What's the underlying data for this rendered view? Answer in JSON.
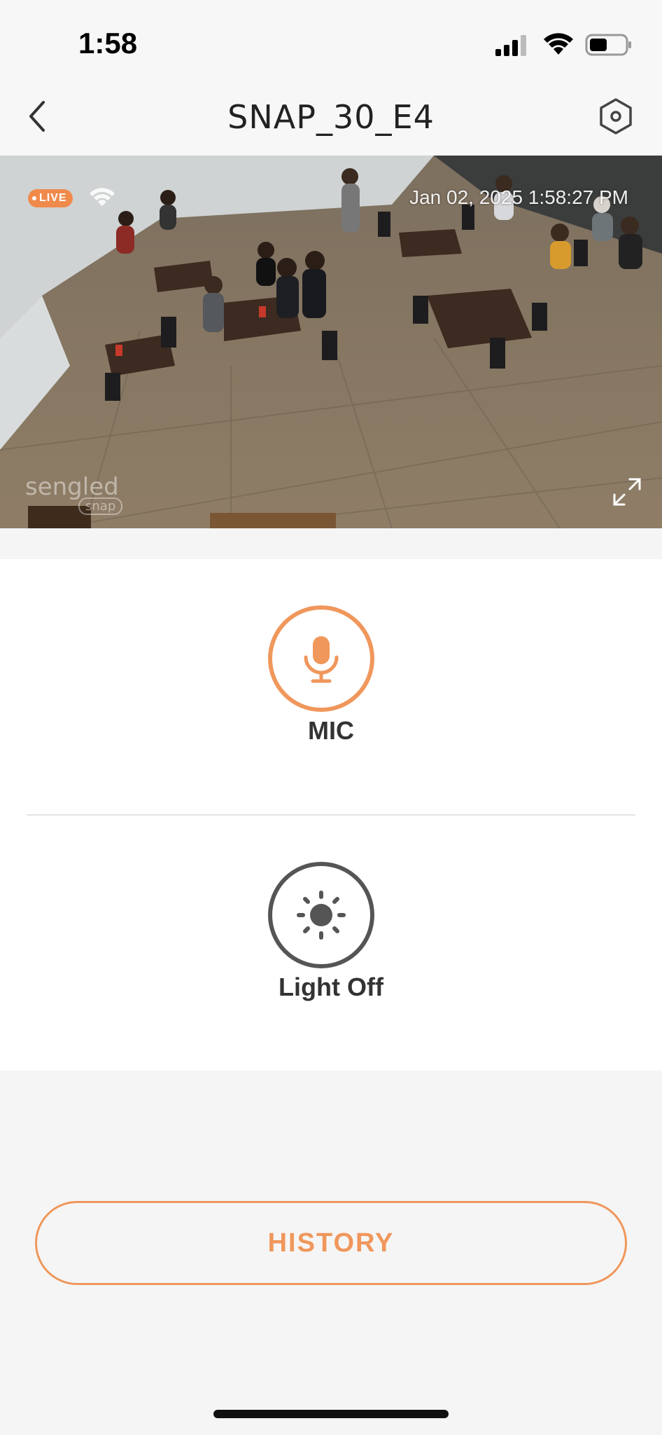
{
  "status_bar": {
    "time": "1:58",
    "icons": [
      "cellular-signal-icon",
      "wifi-icon",
      "battery-icon"
    ]
  },
  "nav": {
    "title": "SNAP_30_E4",
    "back_icon": "chevron-left-icon",
    "settings_icon": "hexagon-settings-icon"
  },
  "video": {
    "live_label": "LIVE",
    "timestamp": "Jan 02, 2025   1:58:27 PM",
    "watermark": "sengled",
    "watermark_sub": "snap",
    "fullscreen_icon": "expand-icon"
  },
  "controls": {
    "mic": {
      "label": "MIC",
      "icon": "microphone-icon",
      "color": "#f0975c"
    },
    "light": {
      "label": "Light Off",
      "icon": "sun-icon",
      "color": "#555555"
    }
  },
  "history": {
    "label": "HISTORY",
    "color": "#f0975c"
  },
  "colors": {
    "accent": "#f0975c",
    "live_badge": "#f08a4b",
    "background": "#f5f5f5"
  }
}
